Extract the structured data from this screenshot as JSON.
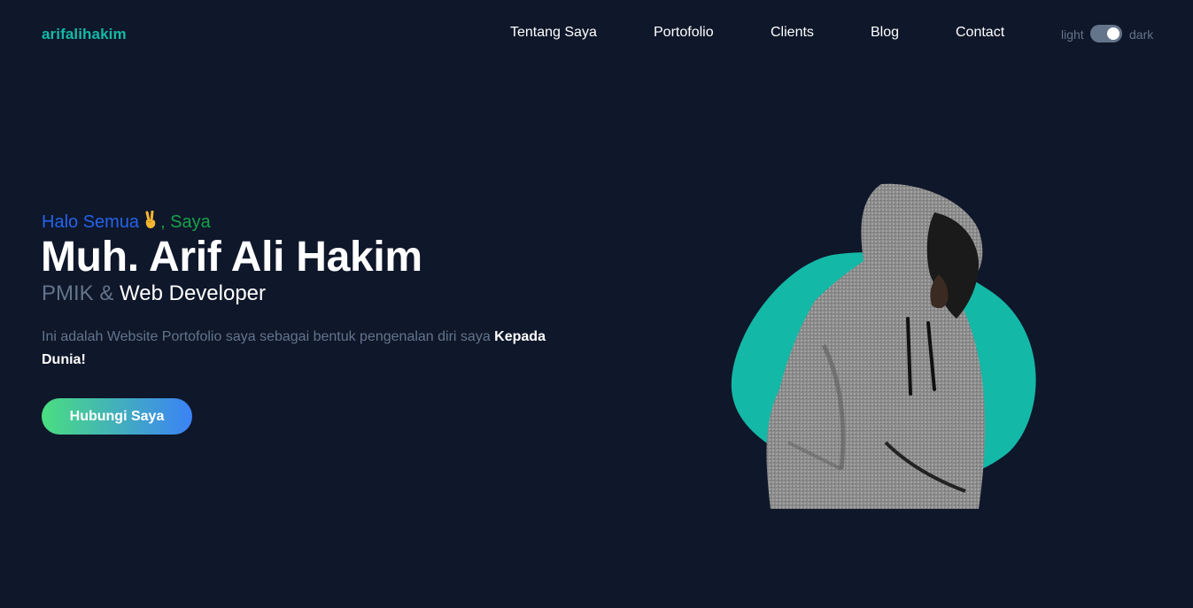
{
  "header": {
    "logo": "arifalihakim",
    "nav": [
      {
        "label": "Tentang Saya"
      },
      {
        "label": "Portofolio"
      },
      {
        "label": "Clients"
      },
      {
        "label": "Blog"
      },
      {
        "label": "Contact"
      }
    ],
    "theme_toggle": {
      "light_label": "light",
      "dark_label": "dark",
      "state": "dark"
    }
  },
  "hero": {
    "greeting_part1": "Halo Semua",
    "greeting_emoji": "victory-hand-icon",
    "greeting_part2": ", Saya",
    "name": "Muh. Arif Ali Hakim",
    "role_part1": "PMIK &",
    "role_part2": "Web Developer",
    "description_plain": "Ini adalah Website Portofolio saya sebagai bentuk pengenalan diri saya",
    "description_strong": "Kepada Dunia!",
    "cta_label": "Hubungi Saya",
    "image": "hooded-person-portrait"
  },
  "colors": {
    "background": "#0f172a",
    "accent": "#14b8a6",
    "muted": "#64748b",
    "greeting_blue": "#2563eb",
    "greeting_green": "#16a34a",
    "cta_gradient_start": "#4ade80",
    "cta_gradient_end": "#3b82f6"
  }
}
